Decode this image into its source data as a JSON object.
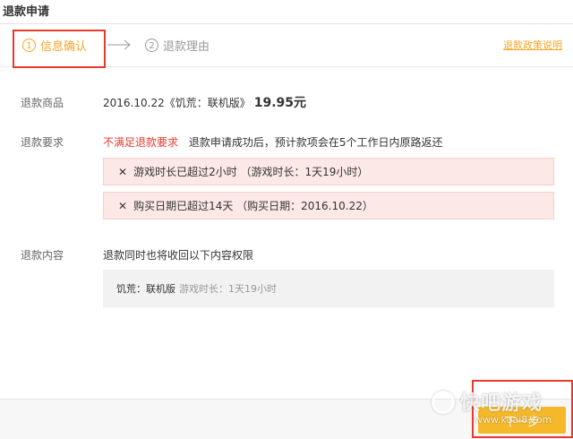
{
  "window": {
    "title": "退款申请"
  },
  "steps": {
    "step1": {
      "num": "1",
      "label": "信息确认"
    },
    "step2": {
      "num": "2",
      "label": "退款理由"
    },
    "policy_link": "退款政策说明"
  },
  "product": {
    "label": "退款商品",
    "name": "2016.10.22《饥荒：联机版》",
    "price": "19.95元"
  },
  "requirements": {
    "label": "退款要求",
    "status": "不满足退款要求",
    "note": "退款申请成功后，预计款项会在5个工作日内原路返还",
    "reasons": [
      {
        "text": "游戏时长已超过2小时 （游戏时长：1天19小时）"
      },
      {
        "text": "购买日期已超过14天 （购买日期：2016.10.22）"
      }
    ]
  },
  "content": {
    "label": "退款内容",
    "note": "退款同时也将收回以下内容权限",
    "game": "饥荒：联机版",
    "duration": "游戏时长：1天19小时"
  },
  "footer": {
    "next_label": "下一步"
  },
  "watermark": {
    "main": "快吧游戏",
    "url": "www.kuai8.com"
  },
  "colors": {
    "accent": "#f5a623",
    "warning": "#e53b2f",
    "button": "#f5b829"
  }
}
